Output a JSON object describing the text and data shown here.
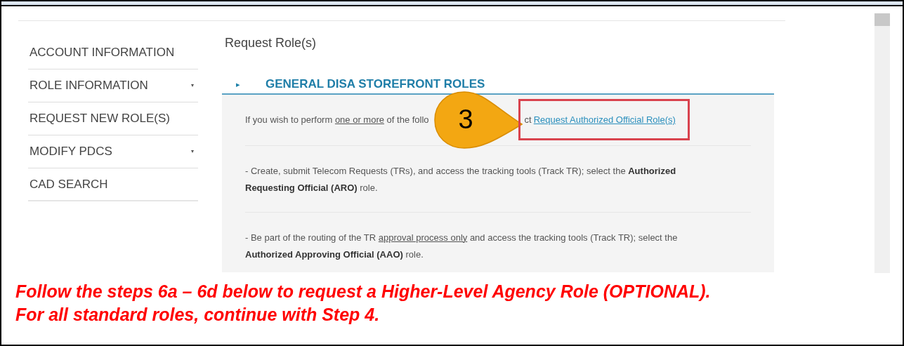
{
  "sidebar": {
    "items": [
      {
        "label": "ACCOUNT INFORMATION",
        "expandable": false
      },
      {
        "label": "ROLE INFORMATION",
        "expandable": true
      },
      {
        "label": "REQUEST NEW ROLE(S)",
        "expandable": false
      },
      {
        "label": "MODIFY PDCS",
        "expandable": true
      },
      {
        "label": "CAD SEARCH",
        "expandable": false
      }
    ]
  },
  "page_title": "Request Role(s)",
  "section": {
    "title": "GENERAL DISA STOREFRONT ROLES",
    "expanded": true,
    "caret": "▸"
  },
  "intro": {
    "before": [
      {
        "kind": "plain",
        "text": "If you wish to perform "
      },
      {
        "kind": "underline",
        "text": "one or more"
      },
      {
        "kind": "plain",
        "text": " of the follo"
      }
    ],
    "after": "ct",
    "link": "Request Authorized Official Role(s)"
  },
  "paragraphs": [
    [
      {
        "kind": "plain",
        "text": "- Create, submit Telecom Requests (TRs), and access the tracking tools (Track TR); select the "
      },
      {
        "kind": "bold",
        "text": "Authorized Requesting Official (ARO)"
      },
      {
        "kind": "plain",
        "text": " role."
      }
    ],
    [
      {
        "kind": "plain",
        "text": "- Be part of the routing of the TR "
      },
      {
        "kind": "underline",
        "text": "approval process only"
      },
      {
        "kind": "plain",
        "text": " and access the tracking tools (Track TR); select the "
      },
      {
        "kind": "bold",
        "text": "Authorized Approving Official (AAO)"
      },
      {
        "kind": "plain",
        "text": " role."
      }
    ]
  ],
  "callout": {
    "number": "3"
  },
  "instruction": {
    "lines": [
      "Follow the steps 6a – 6d below to request a Higher-Level Agency Role (OPTIONAL).",
      "For all standard roles, continue with Step 4."
    ]
  }
}
